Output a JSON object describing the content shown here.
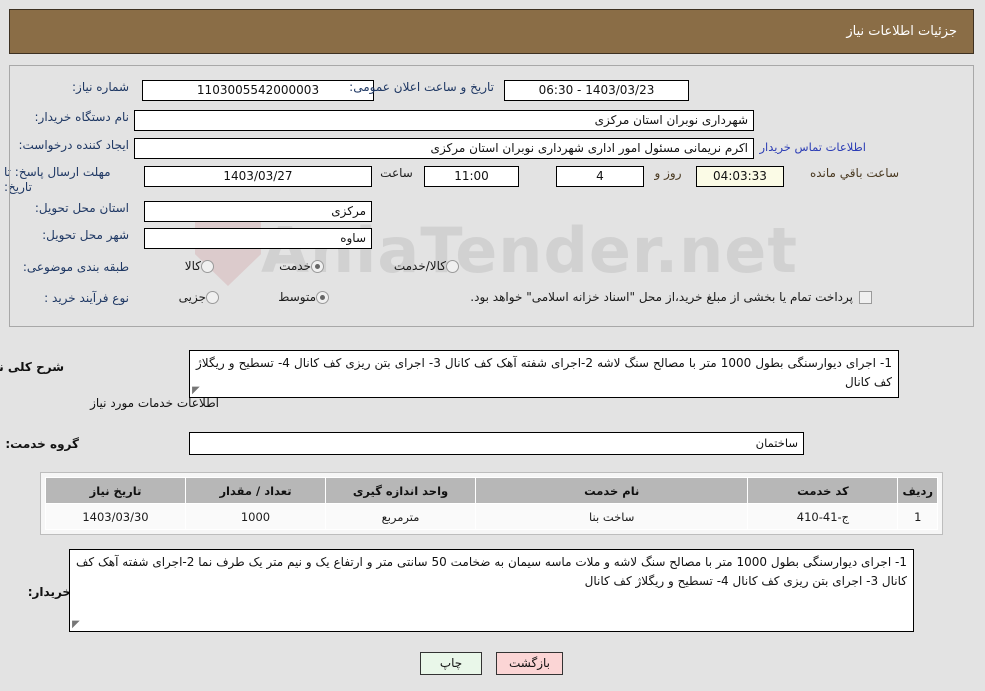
{
  "header": {
    "title": "جزئیات اطلاعات نیاز"
  },
  "form": {
    "need_number_label": "شماره نیاز:",
    "need_number_value": "1103005542000003",
    "announce_label": "تاریخ و ساعت اعلان عمومی:",
    "announce_value": "1403/03/23 - 06:30",
    "buyer_org_label": "نام دستگاه خریدار:",
    "buyer_org_value": "شهرداری نوبران استان مرکزی",
    "creator_label": "ایجاد کننده درخواست:",
    "creator_value": "اکرم نریمانی مسئول امور اداری شهرداری نوبران استان مرکزی",
    "contact_link": "اطلاعات تماس خریدار",
    "deadline_label_line1": "مهلت ارسال پاسخ: تا",
    "deadline_label_line2": "تاریخ:",
    "deadline_date": "1403/03/27",
    "hour_label": "ساعت",
    "deadline_time": "11:00",
    "days_value": "4",
    "days_word": "روز و",
    "countdown_value": "04:03:33",
    "countdown_suffix": "ساعت باقي مانده",
    "province_label": "استان محل تحویل:",
    "province_value": "مرکزی",
    "city_label": "شهر محل تحویل:",
    "city_value": "ساوه",
    "category_label": "طبقه بندی موضوعی:",
    "category_options": [
      "کالا",
      "خدمت",
      "کالا/خدمت"
    ],
    "category_selected": "خدمت",
    "process_label": "نوع فرآیند خرید :",
    "process_options": [
      "جزیی",
      "متوسط"
    ],
    "process_selected": "متوسط",
    "treasury_note": "پرداخت تمام یا بخشی از مبلغ خرید،از محل \"اسناد خزانه اسلامی\" خواهد بود.",
    "treasury_checked": false
  },
  "summary": {
    "label": "شرح کلی نیاز:",
    "text": "1-  اجرای دیوارسنگی بطول 1000 متر با مصالح سنگ لاشه   2-اجرای شفته آهک کف کانال  3- اجرای بتن ریزی کف کانال 4- تسطیح و ریگلاژ کف کانال"
  },
  "services_section": {
    "heading": "اطلاعات خدمات مورد نیاز",
    "group_label": "گروه خدمت:",
    "group_value": "ساختمان"
  },
  "table": {
    "columns": [
      "ردیف",
      "کد خدمت",
      "نام خدمت",
      "واحد اندازه گیری",
      "تعداد / مقدار",
      "تاریخ نیاز"
    ],
    "rows": [
      {
        "row": "1",
        "code": "ج-41-410",
        "name": "ساخت بنا",
        "unit": "مترمربع",
        "quantity": "1000",
        "date": "1403/03/30"
      }
    ]
  },
  "buyer_notes": {
    "label": "توضیحات خریدار:",
    "text": "1-  اجرای دیوارسنگی بطول 1000 متر با مصالح سنگ لاشه و ملات ماسه سیمان به ضخامت 50 سانتی متر و ارتفاع یک و نیم متر یک طرف نما  2-اجرای شفته آهک کف کانال 3- اجرای بتن ریزی کف کانال   4- تسطیح و ریگلاژ کف کانال"
  },
  "buttons": {
    "print": "چاپ",
    "back": "بازگشت"
  },
  "watermark": {
    "text": "AniaTender.net"
  },
  "colors": {
    "header_brown": "#8a6d46",
    "label_blue": "#1f3864",
    "link_blue": "#2c3db5",
    "table_header": "#b7b7b7",
    "print_btn": "#e9f7e9",
    "back_btn": "#fbd5d5",
    "countdown_bg": "#fbfbe6"
  }
}
